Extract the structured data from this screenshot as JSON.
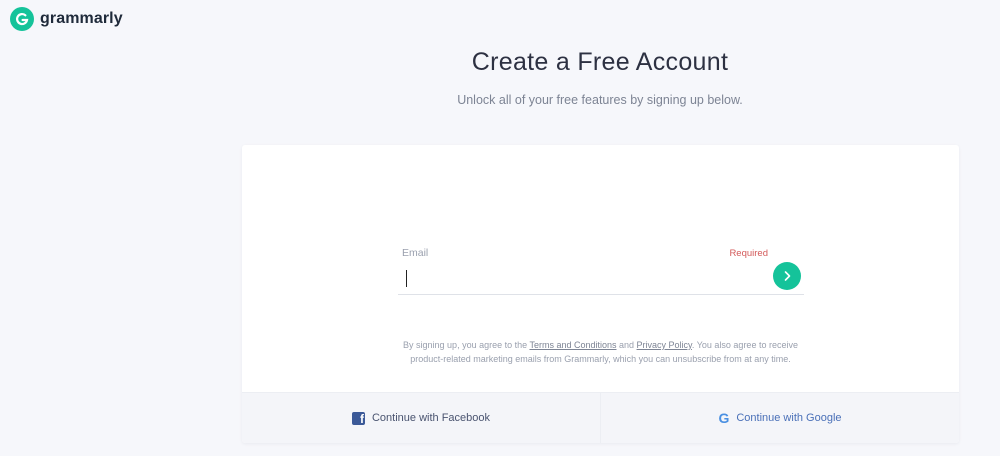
{
  "brand": {
    "name": "grammarly",
    "logo_icon": "grammarly-logo-icon",
    "accent_color": "#15c39a"
  },
  "header": {
    "title": "Create a Free Account",
    "subtitle": "Unlock all of your free features by signing up below."
  },
  "form": {
    "email_label": "Email",
    "required_label": "Required",
    "email_value": "",
    "submit_icon": "chevron-right-icon"
  },
  "terms": {
    "prefix": "By signing up, you agree to the ",
    "terms_link": "Terms and Conditions",
    "and": " and ",
    "privacy_link": "Privacy Policy",
    "suffix_line1": ". You also agree to receive",
    "line2": "product-related marketing emails from Grammarly, which you can unsubscribe from at any time."
  },
  "social": {
    "facebook_label": "Continue with Facebook",
    "google_label": "Continue with Google",
    "facebook_color": "#3b5998",
    "google_color": "#4a90e2"
  }
}
